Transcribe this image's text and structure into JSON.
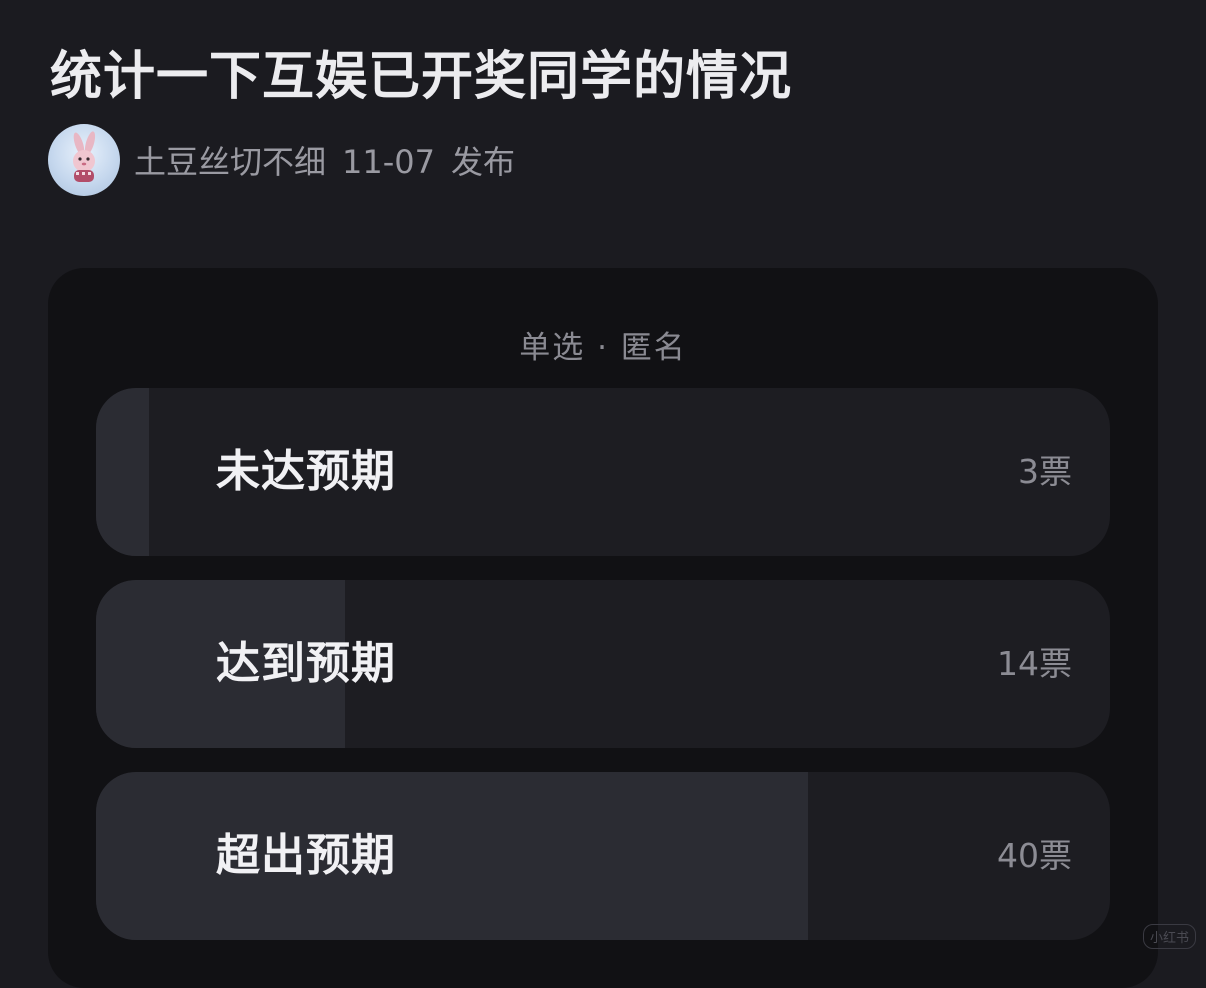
{
  "post": {
    "title": "统计一下互娱已开奖同学的情况",
    "author": "土豆丝切不细",
    "date": "11-07",
    "published_label": "发布",
    "avatar_icon": "bunny-avatar"
  },
  "poll": {
    "mode_label": "单选 · 匿名",
    "options": [
      {
        "label": "未达预期",
        "votes": "3票",
        "count": 3,
        "fill_fraction": 0.0526
      },
      {
        "label": "达到预期",
        "votes": "14票",
        "count": 14,
        "fill_fraction": 0.2456
      },
      {
        "label": "超出预期",
        "votes": "40票",
        "count": 40,
        "fill_fraction": 0.7018
      }
    ]
  },
  "watermark": "小红书",
  "colors": {
    "background": "#1b1b20",
    "card": "#111114",
    "option_bg": "#1d1d22",
    "option_fill": "#2b2c33"
  }
}
